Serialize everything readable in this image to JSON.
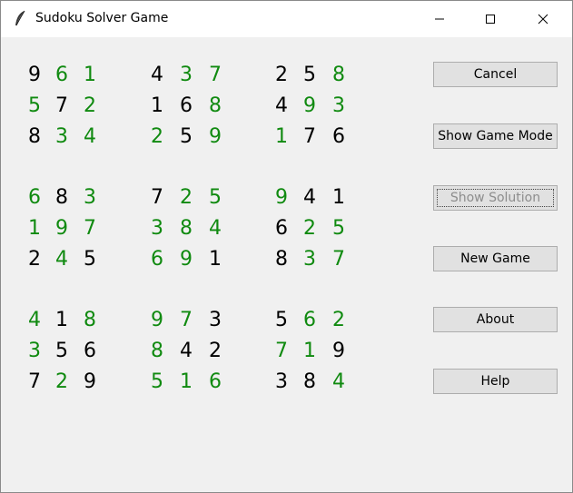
{
  "window": {
    "title": "Sudoku Solver Game",
    "icon": "feather-icon",
    "controls": [
      "minimize-icon",
      "maximize-icon",
      "close-icon"
    ]
  },
  "colors": {
    "given": "#000000",
    "solved": "#108a10"
  },
  "board": {
    "rows": [
      [
        "9",
        "6",
        "1",
        "4",
        "3",
        "7",
        "2",
        "5",
        "8"
      ],
      [
        "5",
        "7",
        "2",
        "1",
        "6",
        "8",
        "4",
        "9",
        "3"
      ],
      [
        "8",
        "3",
        "4",
        "2",
        "5",
        "9",
        "1",
        "7",
        "6"
      ],
      [
        "6",
        "8",
        "3",
        "7",
        "2",
        "5",
        "9",
        "4",
        "1"
      ],
      [
        "1",
        "9",
        "7",
        "3",
        "8",
        "4",
        "6",
        "2",
        "5"
      ],
      [
        "2",
        "4",
        "5",
        "6",
        "9",
        "1",
        "8",
        "3",
        "7"
      ],
      [
        "4",
        "1",
        "8",
        "9",
        "7",
        "3",
        "5",
        "6",
        "2"
      ],
      [
        "3",
        "5",
        "6",
        "8",
        "4",
        "2",
        "7",
        "1",
        "9"
      ],
      [
        "7",
        "2",
        "9",
        "5",
        "1",
        "6",
        "3",
        "8",
        "4"
      ]
    ],
    "solved_mask": [
      "011011001",
      "101001011",
      "011101100",
      "101011100",
      "111111011",
      "010110011",
      "101110011",
      "100100110",
      "010111001"
    ]
  },
  "buttons": [
    {
      "label": "Cancel",
      "name": "cancel-button",
      "enabled": true
    },
    {
      "label": "Show Game Mode",
      "name": "show-game-mode-button",
      "enabled": true
    },
    {
      "label": "Show Solution",
      "name": "show-solution-button",
      "enabled": false
    },
    {
      "label": "New Game",
      "name": "new-game-button",
      "enabled": true
    },
    {
      "label": "About",
      "name": "about-button",
      "enabled": true
    },
    {
      "label": "Help",
      "name": "help-button",
      "enabled": true
    }
  ]
}
